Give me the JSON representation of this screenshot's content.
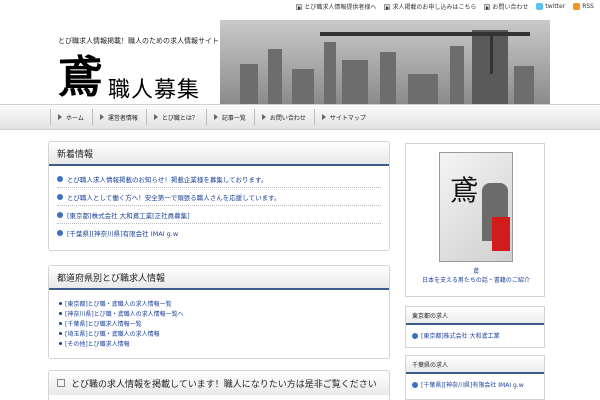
{
  "toplinks": [
    {
      "label": "とび職求人情報提供者様へ",
      "icon": "arrow-icon"
    },
    {
      "label": "求人掲載のお申し込みはこちら",
      "icon": "arrow-icon"
    },
    {
      "label": "お問い合わせ",
      "icon": "arrow-icon"
    },
    {
      "label": "twitter",
      "icon": "twitter-icon"
    },
    {
      "label": "RSS",
      "icon": "rss-icon"
    }
  ],
  "header": {
    "tagline": "とび職求人情報掲載！職人のための求人情報サイト",
    "logo_kanji": "鳶",
    "logo_text": "職人募集"
  },
  "nav": [
    "ホーム",
    "運営者情報",
    "とび職とは？",
    "記事一覧",
    "お問い合わせ",
    "サイトマップ"
  ],
  "news": {
    "title": "新着情報",
    "items": [
      "とび職人求人情報掲載のお知らせ！掲載企業様を募集しております。",
      "とび職人として働く方へ！安全第一で頑張る職人さんを応援しています。",
      "[東京都]株式会社 大和鳶工業[正社員募集]",
      "[千葉県][神奈川県]有限会社 IMAI g.w"
    ]
  },
  "categories": {
    "title": "都道府県別とび職求人情報",
    "items": [
      "[東京都]とび職・鳶職人の求人情報一覧",
      "[神奈川県]とび職・鳶職人の求人情報一覧へ",
      "[千葉県]とび職求人情報一覧",
      "[埼玉県]とび職・鳶職人の求人情報",
      "[その他]とび職求人情報"
    ]
  },
  "bottom_panel": {
    "title": "とび職の求人情報を掲載しています！職人になりたい方は是非ご覧ください"
  },
  "sidebar": {
    "book_kanji": "鳶",
    "book_link_mark": "鳶",
    "book_link": "日本を支える男たちの話・書籍のご紹介",
    "box1_title": "東京都の求人",
    "box1_item": "[東京都]株式会社 大和鳶工業",
    "box2_title": "千葉県の求人",
    "box2_item": "[千葉県][神奈川県]有限会社 IMAI g.w"
  },
  "colors": {
    "accent": "#3c5c8c",
    "link": "#1a3f99",
    "bullet": "#3a6fc4"
  }
}
